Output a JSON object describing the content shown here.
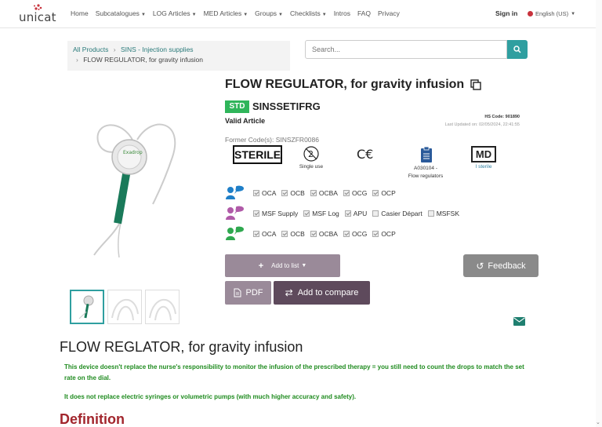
{
  "brand": {
    "logo_text": "unicat"
  },
  "nav": {
    "items": [
      {
        "label": "Home",
        "dropdown": false
      },
      {
        "label": "Subcatalogues",
        "dropdown": true
      },
      {
        "label": "LOG Articles",
        "dropdown": true
      },
      {
        "label": "MED Articles",
        "dropdown": true
      },
      {
        "label": "Groups",
        "dropdown": true
      },
      {
        "label": "Checklists",
        "dropdown": true
      },
      {
        "label": "Intros",
        "dropdown": false
      },
      {
        "label": "FAQ",
        "dropdown": false
      },
      {
        "label": "Privacy",
        "dropdown": false
      }
    ],
    "signin": "Sign in",
    "language": "English (US)"
  },
  "breadcrumb": {
    "root": "All Products",
    "category": "SINS - Injection supplies",
    "current": "FLOW REGULATOR, for gravity infusion"
  },
  "search": {
    "placeholder": "Search..."
  },
  "product": {
    "title": "FLOW REGULATOR, for gravity infusion",
    "badge": "STD",
    "code": "SINSSETIFRG",
    "status": "Valid Article",
    "hs_code": "HS Code: 901890",
    "last_updated": "Last Updated on: 02/05/2024, 22:41:55",
    "former_codes": "Former Code(s): SINSZFR0086",
    "sterile_label": "STERILE",
    "single_use_label": "Single use",
    "ce_mark": "C€",
    "kit_code": "A030104 -",
    "kit_label": "Flow regulators",
    "md_label": "MD",
    "md_sub": "I sterile"
  },
  "checkbox_rows": [
    {
      "people_color": "#1f7fc8",
      "items": [
        {
          "label": "OCA",
          "checked": true
        },
        {
          "label": "OCB",
          "checked": true
        },
        {
          "label": "OCBA",
          "checked": true
        },
        {
          "label": "OCG",
          "checked": true
        },
        {
          "label": "OCP",
          "checked": true
        }
      ]
    },
    {
      "people_color": "#b05aa8",
      "items": [
        {
          "label": "MSF Supply",
          "checked": true
        },
        {
          "label": "MSF Log",
          "checked": true
        },
        {
          "label": "APU",
          "checked": true
        },
        {
          "label": "Casier Départ",
          "checked": false
        },
        {
          "label": "MSFSK",
          "checked": false
        }
      ]
    },
    {
      "people_color": "#2fa84f",
      "items": [
        {
          "label": "OCA",
          "checked": true
        },
        {
          "label": "OCB",
          "checked": true
        },
        {
          "label": "OCBA",
          "checked": true
        },
        {
          "label": "OCG",
          "checked": true
        },
        {
          "label": "OCP",
          "checked": true
        }
      ]
    }
  ],
  "actions": {
    "add_to_list": "Add to list",
    "feedback": "Feedback",
    "pdf": "PDF",
    "compare": "Add to compare"
  },
  "description": {
    "heading": "FLOW REGLATOR, for gravity infusion",
    "note1": "This device doesn't replace the nurse's responsibility to monitor the infusion of the prescribed therapy = you still need to count the drops to match the set rate on the dial.",
    "note2": "It does not replace electric syringes or volumetric pumps (with much higher accuracy and safety).",
    "definition": "Definition"
  }
}
